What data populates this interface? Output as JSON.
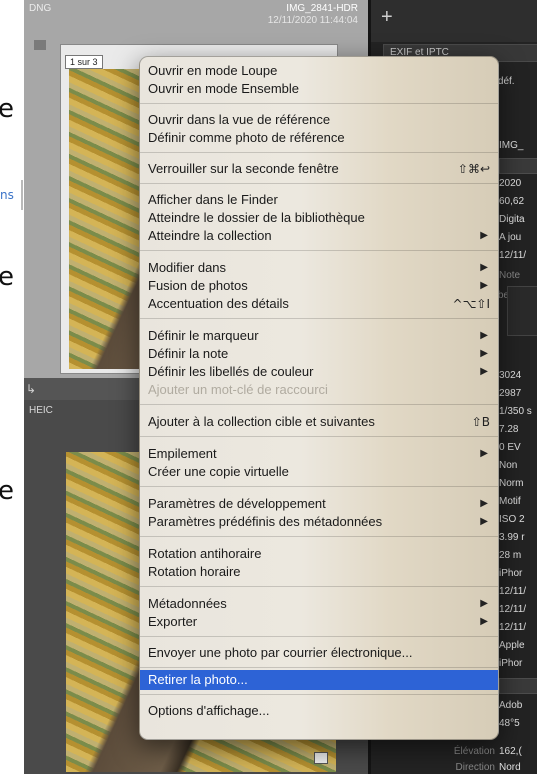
{
  "document": {
    "fragments": [
      "e",
      "ns",
      "e",
      "e"
    ]
  },
  "grid": {
    "cell1": {
      "format": "DNG",
      "filename": "IMG_2841-HDR",
      "datetime": "12/11/2020 11:44:04",
      "badge": "1 sur 3"
    },
    "cell2": {
      "format": "HEIC"
    }
  },
  "right_panel": {
    "plus": "+",
    "exif_tab": "EXIF et IPTC",
    "preset_suffix": "rédéf.",
    "rows": [
      {
        "label": "r",
        "value": "IMG_"
      },
      {
        "label": "r",
        "value": "2020"
      },
      {
        "label": "r",
        "value": "60,62"
      },
      {
        "label": "r",
        "value": "Digita"
      },
      {
        "label": "r",
        "value": "A jou"
      },
      {
        "label": "s",
        "value": "12/11/"
      },
      {
        "label": "",
        "value": "Note"
      },
      {
        "label": "Libellé",
        "value": ""
      },
      {
        "label": "s",
        "value": "3024"
      },
      {
        "label": "s",
        "value": "2987"
      },
      {
        "label": "s",
        "value": "1/350 s"
      },
      {
        "label": "e",
        "value": "7.28"
      },
      {
        "label": "h",
        "value": "0 EV"
      },
      {
        "label": "h",
        "value": "Non"
      },
      {
        "label": "e",
        "value": "Norm"
      },
      {
        "label": "e",
        "value": "Motif"
      },
      {
        "label": "o",
        "value": "ISO 2"
      },
      {
        "label": "e",
        "value": "3.99 r"
      },
      {
        "label": ")",
        "value": "28 m"
      },
      {
        "label": "f",
        "value": "iPhor"
      },
      {
        "label": "n",
        "value": "12/11/"
      },
      {
        "label": "n",
        "value": "12/11/"
      },
      {
        "label": "s",
        "value": "12/11/"
      },
      {
        "label": "e",
        "value": "Apple"
      },
      {
        "label": "e",
        "value": "iPhor"
      },
      {
        "label": "l",
        "value": "Adob"
      },
      {
        "label": "S",
        "value": "48°5"
      },
      {
        "label": "Élévation",
        "value": "162,("
      },
      {
        "label": "Direction",
        "value": "Nord"
      }
    ]
  },
  "menu": {
    "items": [
      {
        "label": "Ouvrir en mode Loupe"
      },
      {
        "label": "Ouvrir en mode Ensemble"
      },
      {
        "label": "Ouvrir dans la vue de référence"
      },
      {
        "label": "Définir comme photo de référence"
      },
      {
        "label": "Verrouiller sur la seconde fenêtre",
        "shortcut": "⇧⌘↩"
      },
      {
        "label": "Afficher dans le Finder"
      },
      {
        "label": "Atteindre le dossier de la bibliothèque"
      },
      {
        "label": "Atteindre la collection",
        "submenu": "▶"
      },
      {
        "label": "Modifier dans",
        "submenu": "▶"
      },
      {
        "label": "Fusion de photos",
        "submenu": "▶"
      },
      {
        "label": "Accentuation des détails",
        "shortcut": "^⌥⇧I"
      },
      {
        "label": "Définir le marqueur",
        "submenu": "▶"
      },
      {
        "label": "Définir la note",
        "submenu": "▶"
      },
      {
        "label": "Définir les libellés de couleur",
        "submenu": "▶"
      },
      {
        "label": "Ajouter un mot-clé de raccourci",
        "disabled": true
      },
      {
        "label": "Ajouter à la collection cible et suivantes",
        "shortcut": "⇧B"
      },
      {
        "label": "Empilement",
        "submenu": "▶"
      },
      {
        "label": "Créer une copie virtuelle"
      },
      {
        "label": "Paramètres de développement",
        "submenu": "▶"
      },
      {
        "label": "Paramètres prédéfinis des métadonnées",
        "submenu": "▶"
      },
      {
        "label": "Rotation antihoraire"
      },
      {
        "label": "Rotation horaire"
      },
      {
        "label": "Métadonnées",
        "submenu": "▶"
      },
      {
        "label": "Exporter",
        "submenu": "▶"
      },
      {
        "label": "Envoyer une photo par courrier électronique..."
      },
      {
        "label": "Retirer la photo...",
        "highlighted": true
      },
      {
        "label": "Options d'affichage..."
      }
    ],
    "highlight_color": "#2d63d6"
  }
}
